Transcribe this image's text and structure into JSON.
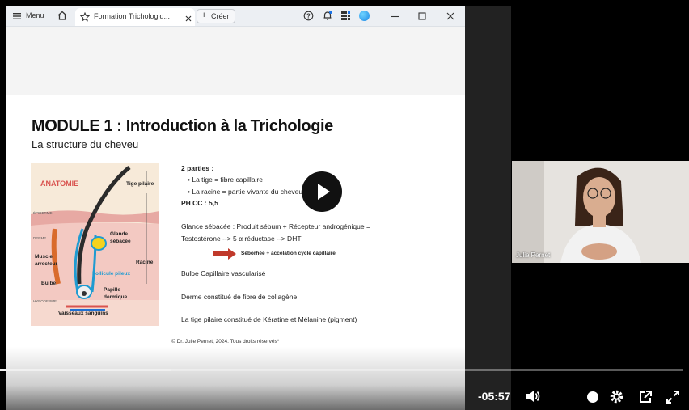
{
  "browser": {
    "menu_label": "Menu",
    "tab_title": "Formation Trichologiq...",
    "new_button_label": "Créer"
  },
  "slide": {
    "title": "MODULE 1 : Introduction à la Trichologie",
    "subtitle": "La structure du cheveu",
    "parts_heading": "2 parties :",
    "bullet_1": "La tige = fibre capillaire",
    "bullet_2": "La racine = partie vivante du cheveu",
    "ph": "PH CC : 5,5",
    "gland_line_1": "Glance sébacée : Produit sébum + Récepteur androgénique =",
    "gland_line_2": "Testostérone --> 5 α réductase --> DHT",
    "arrow_text": "Séborhée + accélation cycle capillaire",
    "bulbe": "Bulbe Capillaire vascularisé",
    "derme": "Derme constitué de fibre de collagène",
    "tige": "La tige pilaire constitué de Kératine et Mélanine (pigment)",
    "copyright": "© Dr. Julie Pernet, 2024. Tous droits réservés*"
  },
  "anatomy": {
    "title": "ANATOMIE",
    "tige_pilaire": "Tige pilaire",
    "epiderme": "ÉPIDERME",
    "derme": "DERME",
    "hypoderme": "HYPODERME",
    "glande": "Glande",
    "sebacee": "sébacée",
    "muscle": "Muscle",
    "arrecteur": "arrecteur",
    "racine": "Racine",
    "follicule": "Follicule pileux",
    "bulbe": "Bulbe",
    "papille": "Papille",
    "dermique": "dermique",
    "vaisseaux": "Vaisseaux sanguins"
  },
  "player": {
    "time_remaining": "-05:57",
    "progress_fraction": 0.25,
    "presenter_name": "Julie Pernet"
  },
  "colors": {
    "arrow_red": "#c0392b",
    "follicle_blue": "#1f9bd1",
    "anatomy_red": "#d9534f"
  }
}
